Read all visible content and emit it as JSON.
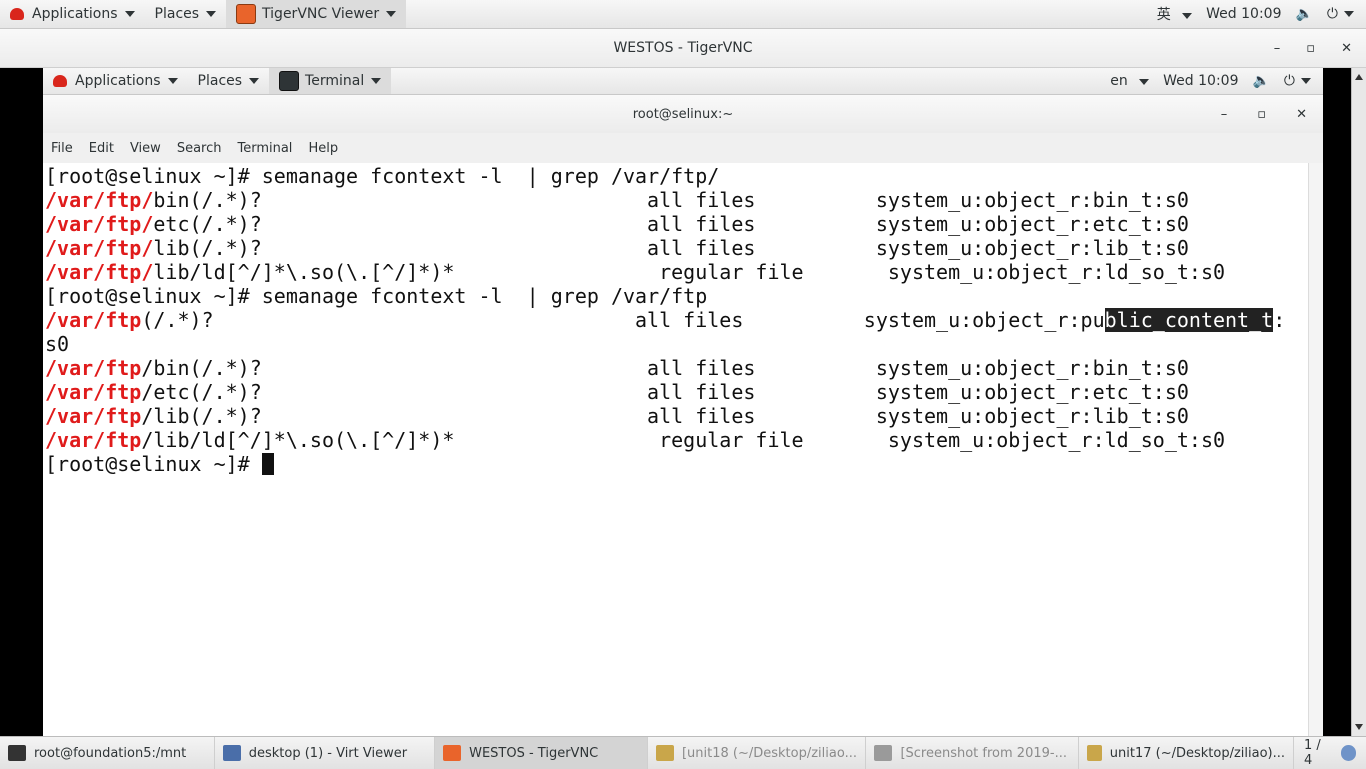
{
  "outer_bar": {
    "applications": "Applications",
    "places": "Places",
    "app": "TigerVNC Viewer",
    "input_method": "英",
    "clock": "Wed 10:09"
  },
  "vnc_window": {
    "title": "WESTOS - TigerVNC",
    "min": "–",
    "max": "▫",
    "close": "✕"
  },
  "inner_bar": {
    "applications": "Applications",
    "places": "Places",
    "app": "Terminal",
    "lang": "en",
    "clock": "Wed 10:09"
  },
  "terminal": {
    "title": "root@selinux:~",
    "menu": [
      "File",
      "Edit",
      "View",
      "Search",
      "Terminal",
      "Help"
    ],
    "lines": [
      {
        "prompt": "[root@selinux ~]# ",
        "cmd": "semanage fcontext -l  | grep /var/ftp/"
      },
      {
        "red": "/var/ftp/",
        "rest": "bin(/.*)?                                all files          system_u:object_r:bin_t:s0"
      },
      {
        "red": "/var/ftp/",
        "rest": "etc(/.*)?                                all files          system_u:object_r:etc_t:s0"
      },
      {
        "red": "/var/ftp/",
        "rest": "lib(/.*)?                                all files          system_u:object_r:lib_t:s0"
      },
      {
        "red": "/var/ftp/",
        "rest": "lib/ld[^/]*\\.so(\\.[^/]*)*                 regular file       system_u:object_r:ld_so_t:s0"
      },
      {
        "prompt": "[root@selinux ~]# ",
        "cmd": "semanage fcontext -l  | grep /var/ftp"
      },
      {
        "red": "/var/ftp",
        "rest": "(/.*)?                                   all files          system_u:object_r:pu",
        "sel": "blic_content_t",
        "after": ":"
      },
      {
        "plain": "s0"
      },
      {
        "red": "/var/ftp",
        "rest": "/bin(/.*)?                                all files          system_u:object_r:bin_t:s0"
      },
      {
        "red": "/var/ftp",
        "rest": "/etc(/.*)?                                all files          system_u:object_r:etc_t:s0"
      },
      {
        "red": "/var/ftp",
        "rest": "/lib(/.*)?                                all files          system_u:object_r:lib_t:s0"
      },
      {
        "red": "/var/ftp",
        "rest": "/lib/ld[^/]*\\.so(\\.[^/]*)*                 regular file       system_u:object_r:ld_so_t:s0"
      },
      {
        "prompt": "[root@selinux ~]# ",
        "cursor": true
      }
    ]
  },
  "taskbar": {
    "items": [
      {
        "label": "root@foundation5:/mnt",
        "color": "#333333"
      },
      {
        "label": "desktop (1) - Virt Viewer",
        "color": "#4a6ea9"
      },
      {
        "label": "WESTOS - TigerVNC",
        "color": "#e9642b",
        "active": true
      },
      {
        "label": "[unit18 (~/Desktop/ziliao...",
        "color": "#c9a64a",
        "dim": true
      },
      {
        "label": "[Screenshot from 2019-...",
        "color": "#9a9a9a",
        "dim": true
      },
      {
        "label": "unit17 (~/Desktop/ziliao)...",
        "color": "#c9a64a"
      }
    ],
    "pager": "1 / 4"
  }
}
